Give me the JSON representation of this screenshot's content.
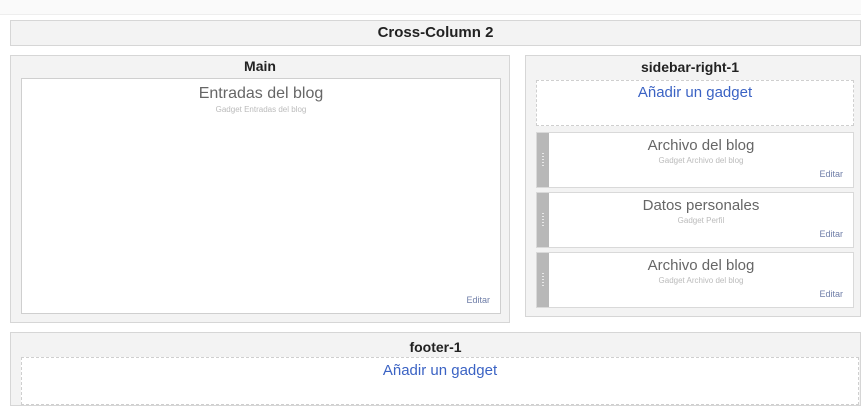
{
  "cross_column": {
    "title": "Cross-Column 2"
  },
  "main": {
    "title": "Main",
    "gadget": {
      "title": "Entradas del blog",
      "subtitle": "Gadget Entradas del blog",
      "edit": "Editar"
    }
  },
  "sidebar": {
    "title": "sidebar-right-1",
    "add_gadget": "Añadir un gadget",
    "gadgets": [
      {
        "title": "Archivo del blog",
        "subtitle": "Gadget Archivo del blog",
        "edit": "Editar"
      },
      {
        "title": "Datos personales",
        "subtitle": "Gadget Perfil",
        "edit": "Editar"
      },
      {
        "title": "Archivo del blog",
        "subtitle": "Gadget Archivo del blog",
        "edit": "Editar"
      }
    ]
  },
  "footer": {
    "title": "footer-1",
    "add_gadget": "Añadir un gadget"
  }
}
